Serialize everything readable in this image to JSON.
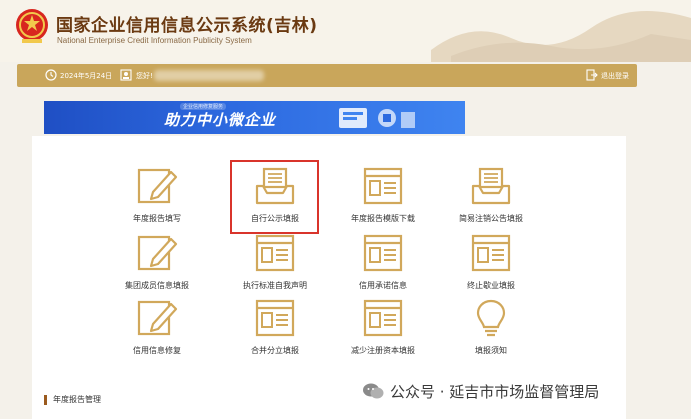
{
  "header": {
    "title": "国家企业信用信息公示系统(吉林)",
    "subtitle": "National Enterprise Credit Information Publicity System"
  },
  "infobar": {
    "date": "2024年5月24日",
    "greeting": "您好!",
    "logout_label": "退出登录"
  },
  "banner": {
    "headline": "助力中小微企业",
    "tag": "企业信用修复服务"
  },
  "tiles": [
    {
      "label": "年度报告填写",
      "icon": "pencil-icon"
    },
    {
      "label": "自行公示填报",
      "icon": "tray-icon"
    },
    {
      "label": "年度报告模版下载",
      "icon": "form-icon"
    },
    {
      "label": "简易注销公告填报",
      "icon": "tray-icon"
    },
    {
      "label": "集团成员信息填报",
      "icon": "pencil-icon"
    },
    {
      "label": "执行标准自我声明",
      "icon": "form-icon"
    },
    {
      "label": "信用承诺信息",
      "icon": "form-icon"
    },
    {
      "label": "终止歇业填报",
      "icon": "form-icon"
    },
    {
      "label": "信用信息修复",
      "icon": "pencil-icon"
    },
    {
      "label": "合并分立填报",
      "icon": "form-icon"
    },
    {
      "label": "减少注册资本填报",
      "icon": "form-icon"
    },
    {
      "label": "填报须知",
      "icon": "bulb-icon"
    }
  ],
  "section": {
    "title": "年度报告管理"
  },
  "watermark": {
    "text": "公众号 · 延吉市市场监督管理局"
  },
  "colors": {
    "brand_brown": "#6b3a12",
    "gold_bar": "#c9a65b",
    "icon_gold": "#d1a85b",
    "highlight_red": "#d9342b",
    "banner_blue": "#2d6ae0"
  }
}
